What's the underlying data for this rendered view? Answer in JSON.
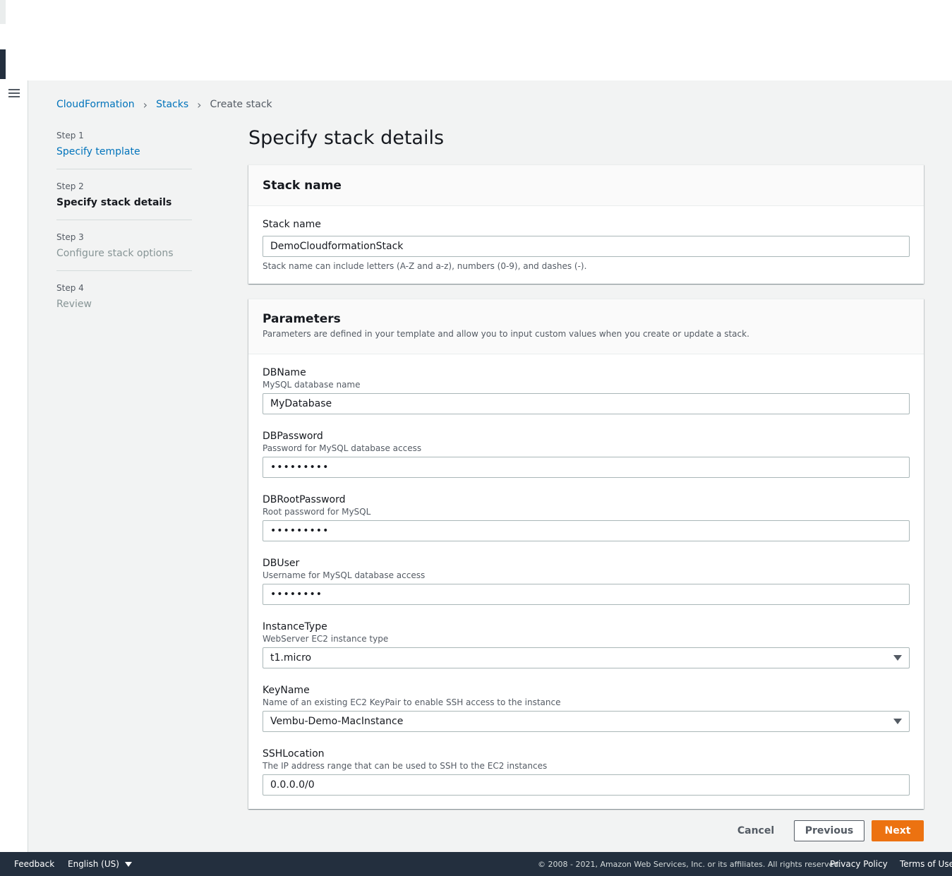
{
  "breadcrumb": {
    "items": [
      "CloudFormation",
      "Stacks"
    ],
    "current": "Create stack"
  },
  "steps": [
    {
      "num": "Step 1",
      "label": "Specify template"
    },
    {
      "num": "Step 2",
      "label": "Specify stack details"
    },
    {
      "num": "Step 3",
      "label": "Configure stack options"
    },
    {
      "num": "Step 4",
      "label": "Review"
    }
  ],
  "page_title": "Specify stack details",
  "stack_name_panel": {
    "title": "Stack name",
    "field_label": "Stack name",
    "value": "DemoCloudformationStack",
    "constraint": "Stack name can include letters (A-Z and a-z), numbers (0-9), and dashes (-)."
  },
  "parameters_panel": {
    "title": "Parameters",
    "description": "Parameters are defined in your template and allow you to input custom values when you create or update a stack.",
    "fields": [
      {
        "label": "DBName",
        "desc": "MySQL database name",
        "value": "MyDatabase"
      },
      {
        "label": "DBPassword",
        "desc": "Password for MySQL database access",
        "value": "•••••••••"
      },
      {
        "label": "DBRootPassword",
        "desc": "Root password for MySQL",
        "value": "•••••••••"
      },
      {
        "label": "DBUser",
        "desc": "Username for MySQL database access",
        "value": "••••••••"
      },
      {
        "label": "InstanceType",
        "desc": "WebServer EC2 instance type",
        "value": "t1.micro"
      },
      {
        "label": "KeyName",
        "desc": "Name of an existing EC2 KeyPair to enable SSH access to the instance",
        "value": "Vembu-Demo-MacInstance"
      },
      {
        "label": "SSHLocation",
        "desc": "The IP address range that can be used to SSH to the EC2 instances",
        "value": "0.0.0.0/0"
      }
    ]
  },
  "actions": {
    "cancel": "Cancel",
    "previous": "Previous",
    "next": "Next"
  },
  "footer": {
    "feedback": "Feedback",
    "language": "English (US)",
    "copyright": "© 2008 - 2021, Amazon Web Services, Inc. or its affiliates. All rights reserved.",
    "privacy": "Privacy Policy",
    "terms": "Terms of Use"
  },
  "colors": {
    "accent": "#ec7211",
    "link": "#0073bb",
    "footer_bg": "#232f3e"
  }
}
